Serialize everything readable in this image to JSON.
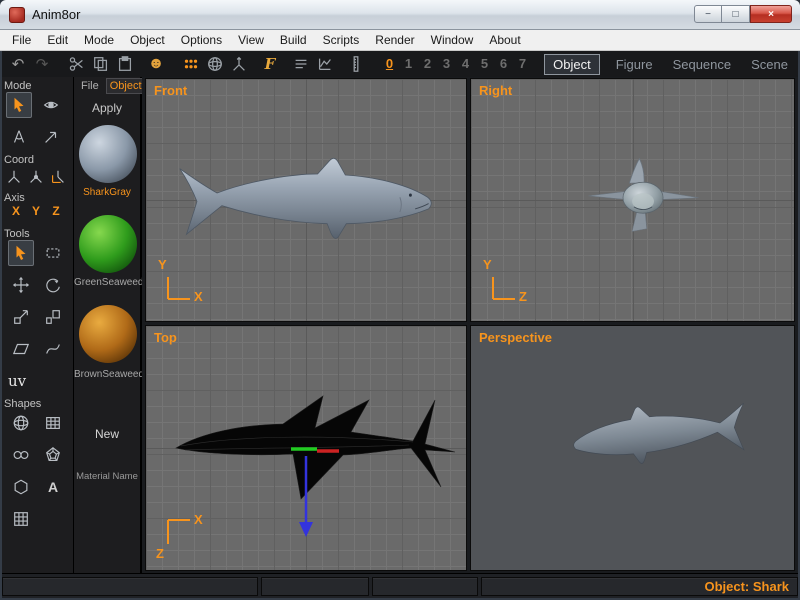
{
  "window": {
    "title": "Anim8or"
  },
  "window_controls": {
    "minimize": "−",
    "maximize": "□",
    "close": "×"
  },
  "menu": {
    "items": [
      "File",
      "Edit",
      "Mode",
      "Object",
      "Options",
      "View",
      "Build",
      "Scripts",
      "Render",
      "Window",
      "About"
    ]
  },
  "toolbar": {
    "icons": {
      "undo": "↶",
      "redo": "↷",
      "smiley": "☻",
      "script": "F"
    },
    "frames": [
      "0",
      "1",
      "2",
      "3",
      "4",
      "5",
      "6",
      "7"
    ],
    "active_frame": "0",
    "tabs": [
      {
        "label": "Object",
        "active": true
      },
      {
        "label": "Figure",
        "active": false
      },
      {
        "label": "Sequence",
        "active": false
      },
      {
        "label": "Scene",
        "active": false
      }
    ]
  },
  "sidebar": {
    "sections": {
      "mode": "Mode",
      "coord": "Coord",
      "axis": "Axis",
      "tools": "Tools",
      "uv": "uv",
      "shapes": "Shapes"
    },
    "axis_toggles": [
      "X",
      "Y",
      "Z"
    ],
    "text_shape": "A"
  },
  "materials": {
    "tabs": {
      "file": "File",
      "object": "Object"
    },
    "apply": "Apply",
    "new": "New",
    "name_label": "Material Name",
    "items": [
      {
        "name": "SharkGray",
        "selected": true,
        "color": "#8a98a8"
      },
      {
        "name": "GreenSeaweed",
        "selected": false,
        "color": "#2f9c1c"
      },
      {
        "name": "BrownSeaweed",
        "selected": false,
        "color": "#b06a18"
      }
    ]
  },
  "viewports": {
    "front": {
      "label": "Front",
      "vaxis": "Y",
      "haxis": "X"
    },
    "right": {
      "label": "Right",
      "vaxis": "Y",
      "haxis": "Z"
    },
    "top": {
      "label": "Top",
      "haxis": "X",
      "vaxis": "Z"
    },
    "perspective": {
      "label": "Perspective"
    }
  },
  "statusbar": {
    "object_info": "Object: Shark"
  },
  "colors": {
    "accent": "#f7941d",
    "viewport_bg": "#6a6a6a",
    "grid_line": "#757575",
    "close_button": "#c8402f",
    "axis_widget": {
      "x": "#cc2222",
      "y": "#22cc22",
      "z": "#3333dd"
    }
  }
}
